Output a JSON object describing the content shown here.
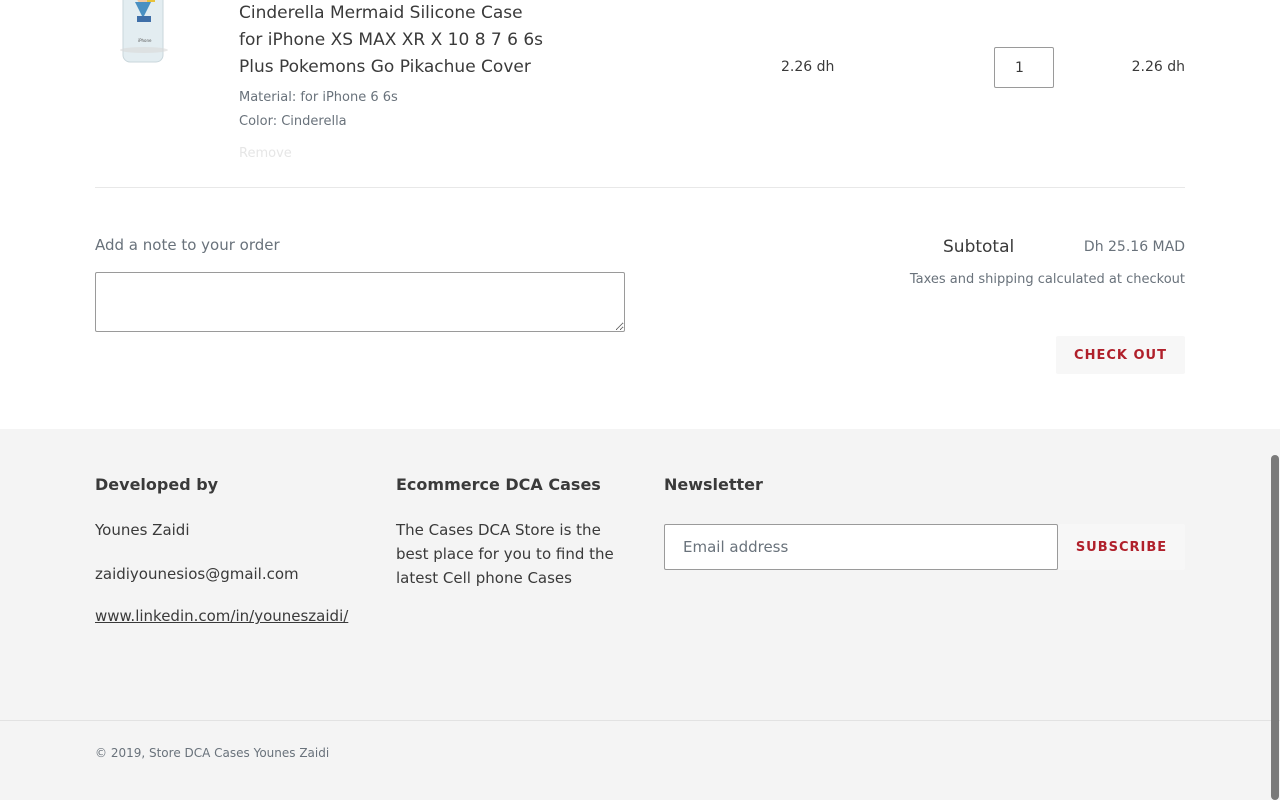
{
  "cart_item": {
    "title_lines": [
      "Cinderella Mermaid Silicone Case",
      "for iPhone XS MAX XR X 10 8 7 6 6s",
      "Plus Pokemons Go Pikachue Cover"
    ],
    "material": "Material: for iPhone 6 6s",
    "color": "Color: Cinderella",
    "remove_label": "Remove",
    "price": "2.26 dh",
    "quantity": "1",
    "line_total": "2.26 dh"
  },
  "cart_footer": {
    "note_label": "Add a note to your order",
    "subtotal_label": "Subtotal",
    "subtotal_value": "Dh 25.16 MAD",
    "tax_note": "Taxes and shipping calculated at checkout",
    "checkout_label": "CHECK OUT"
  },
  "footer": {
    "developed_by": {
      "heading": "Developed by",
      "name": "Younes Zaidi",
      "email": "zaidiyounesios@gmail.com",
      "linkedin": "www.linkedin.com/in/youneszaidi/"
    },
    "about": {
      "heading": "Ecommerce DCA Cases",
      "lines": [
        "The Cases DCA Store is the",
        "best place for you to find the",
        "latest Cell phone Cases"
      ]
    },
    "newsletter": {
      "heading": "Newsletter",
      "email_placeholder": "Email address",
      "subscribe_label": "SUBSCRIBE"
    },
    "copyright": "© 2019, Store DCA Cases Younes Zaidi"
  },
  "colors": {
    "accent": "#b0202b",
    "footer_bg": "#f4f4f4",
    "text": "#3a3a3a",
    "muted": "#69727b"
  }
}
